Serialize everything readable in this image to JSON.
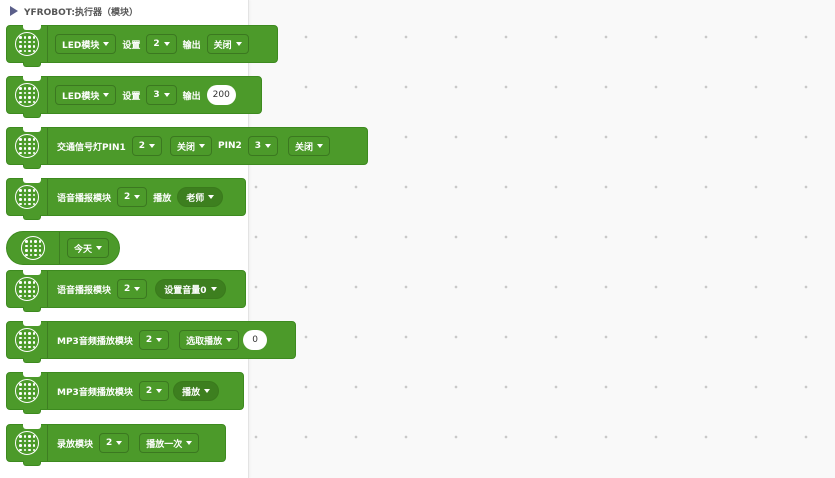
{
  "category": {
    "title": "YFROBOT:执行器（模块）"
  },
  "blocks": [
    {
      "a": "LED模块",
      "b": "2",
      "c": "设置",
      "d": "输出",
      "e": "关闭"
    },
    {
      "a": "LED模块",
      "b": "3",
      "c": "设置",
      "d": "输出",
      "e": "200"
    },
    {
      "a": "交通信号灯PIN1",
      "b": "2",
      "c": "关闭",
      "d": "PIN2",
      "e": "3",
      "f": "关闭"
    },
    {
      "a": "语音播报模块",
      "b": "2",
      "c": "播放",
      "d": "老师"
    },
    {
      "a": "今天"
    },
    {
      "a": "语音播报模块",
      "b": "2",
      "c": "设置音量0"
    },
    {
      "a": "MP3音频播放模块",
      "b": "2",
      "c": "选取播放",
      "d": "0"
    },
    {
      "a": "MP3音频播放模块",
      "b": "2",
      "c": "播放"
    },
    {
      "a": "录放模块",
      "b": "2",
      "c": "播放一次"
    }
  ]
}
